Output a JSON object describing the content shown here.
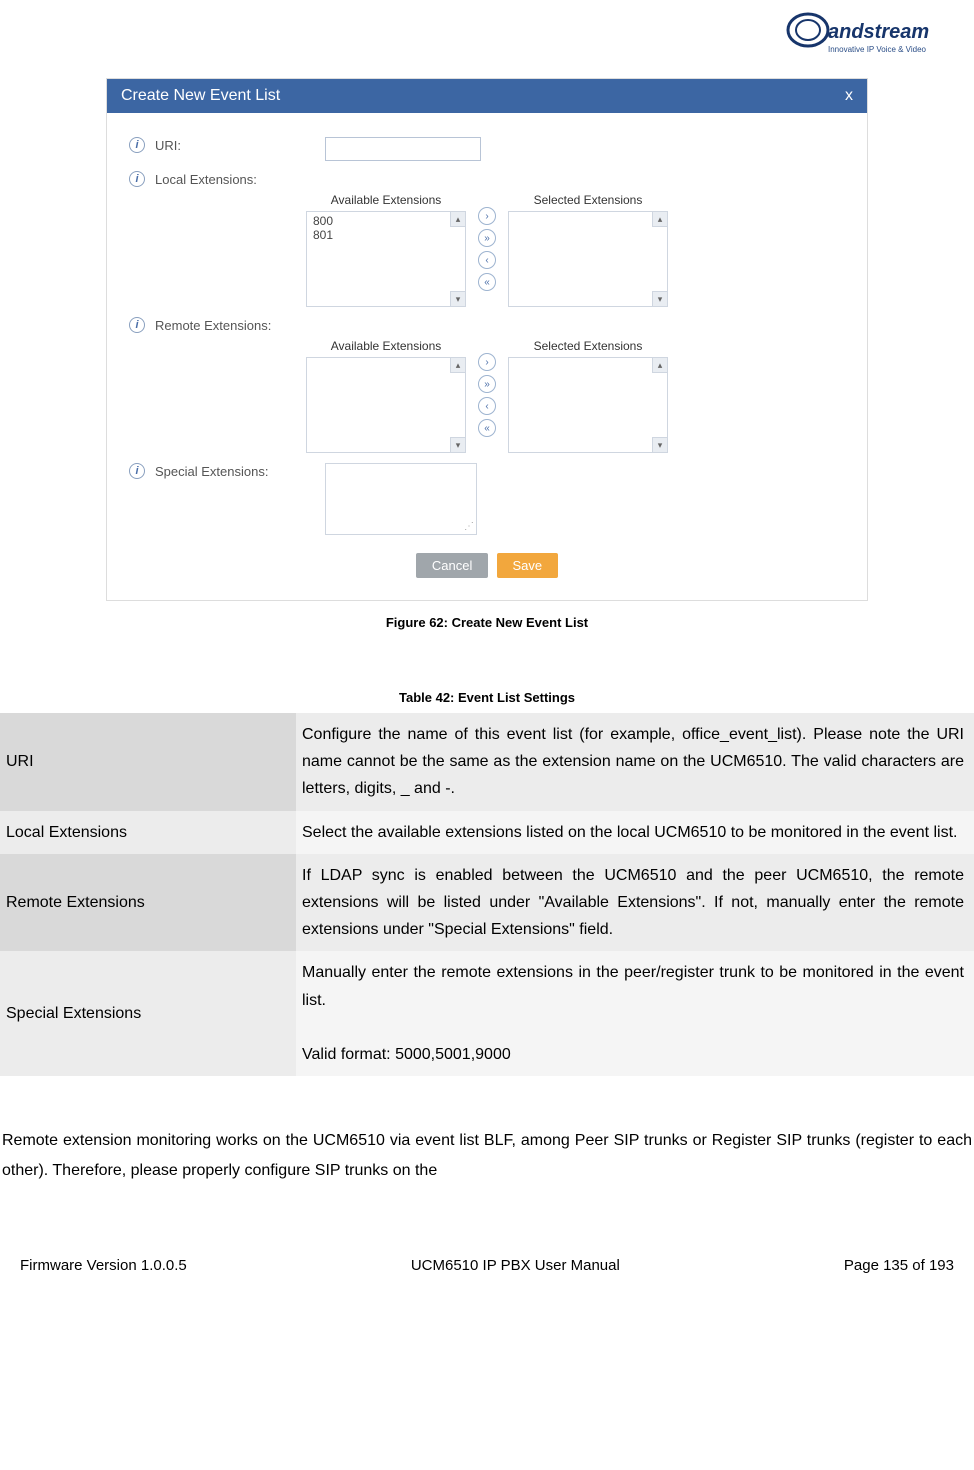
{
  "logo": {
    "brand": "Grandstream",
    "tagline": "Innovative IP Voice & Video"
  },
  "dialog": {
    "title": "Create New Event List",
    "close": "x",
    "rows": {
      "uri": "URI:",
      "local": "Local Extensions:",
      "remote": "Remote Extensions:",
      "special": "Special Extensions:"
    },
    "dual": {
      "available": "Available Extensions",
      "selected": "Selected Extensions",
      "localItems": [
        "800",
        "801"
      ]
    },
    "buttons": {
      "cancel": "Cancel",
      "save": "Save"
    }
  },
  "figureCaption": "Figure 62: Create New Event List",
  "tableCaption": "Table 42: Event List Settings",
  "table": [
    {
      "k": "URI",
      "v": "Configure the name of this event list (for example, office_event_list). Please note the URI name cannot be the same as the extension name on the UCM6510. The valid characters are letters, digits, _ and -."
    },
    {
      "k": "Local Extensions",
      "v": "Select the available extensions listed on the local UCM6510 to be monitored in the event list."
    },
    {
      "k": "Remote Extensions",
      "v": "If LDAP sync is enabled between the UCM6510 and the peer UCM6510, the remote extensions will be listed under \"Available Extensions\". If not, manually enter the remote extensions under \"Special Extensions\" field."
    },
    {
      "k": "Special Extensions",
      "v": "Manually enter the remote extensions in the peer/register trunk to be monitored in the event list.\n\nValid format: 5000,5001,9000"
    }
  ],
  "paragraph": "Remote extension monitoring works on the UCM6510 via event list BLF, among Peer SIP trunks or Register SIP trunks (register to each other). Therefore, please properly configure SIP trunks on the",
  "footer": {
    "left": "Firmware Version 1.0.0.5",
    "center": "UCM6510 IP PBX User Manual",
    "right": "Page 135 of 193"
  }
}
